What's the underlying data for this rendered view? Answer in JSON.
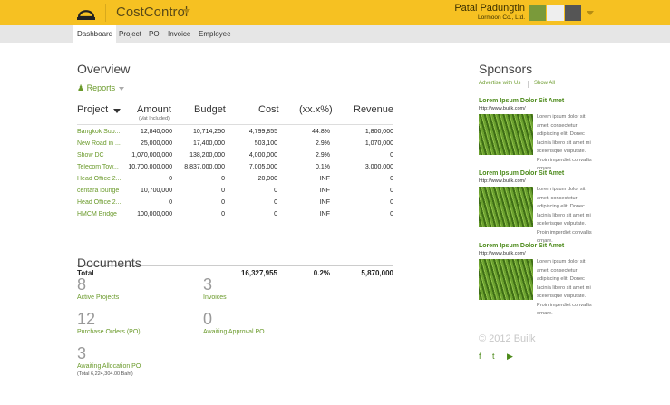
{
  "app": {
    "brand": "CostControl"
  },
  "user": {
    "name": "Patai Padungtin",
    "company": "Lormoon Co., Ltd."
  },
  "nav": {
    "tabs": [
      "Dashboard",
      "Project",
      "PO",
      "Invoice",
      "Employee"
    ],
    "active": "Dashboard"
  },
  "overview": {
    "title": "Overview",
    "reports_label": "Reports",
    "columns": {
      "project": "Project",
      "amount": "Amount",
      "amount_sub": "(Vat Included)",
      "budget": "Budget",
      "cost": "Cost",
      "ratio": "(xx.x%)",
      "revenue": "Revenue"
    },
    "rows": [
      {
        "project": "Bangkok Sup...",
        "amount": "12,840,000",
        "budget": "10,714,250",
        "cost": "4,799,855",
        "ratio": "44.8%",
        "revenue": "1,800,000"
      },
      {
        "project": "New Road in ...",
        "amount": "25,000,000",
        "budget": "17,400,000",
        "cost": "503,100",
        "ratio": "2.9%",
        "revenue": "1,070,000"
      },
      {
        "project": "Show DC",
        "amount": "1,070,000,000",
        "budget": "138,200,000",
        "cost": "4,000,000",
        "ratio": "2.9%",
        "revenue": "0"
      },
      {
        "project": "Telecom Tow...",
        "amount": "10,700,000,000",
        "budget": "8,837,000,000",
        "cost": "7,005,000",
        "ratio": "0.1%",
        "revenue": "3,000,000"
      },
      {
        "project": "Head Office 2...",
        "amount": "0",
        "budget": "0",
        "cost": "20,000",
        "ratio": "INF",
        "revenue": "0"
      },
      {
        "project": "centara lounge",
        "amount": "10,700,000",
        "budget": "0",
        "cost": "0",
        "ratio": "INF",
        "revenue": "0"
      },
      {
        "project": "Head Office 2...",
        "amount": "0",
        "budget": "0",
        "cost": "0",
        "ratio": "INF",
        "revenue": "0"
      },
      {
        "project": "HMCM Bridge",
        "amount": "100,000,000",
        "budget": "0",
        "cost": "0",
        "ratio": "INF",
        "revenue": "0"
      }
    ],
    "total": {
      "label": "Total",
      "cost": "16,327,955",
      "ratio": "0.2%",
      "revenue": "5,870,000"
    }
  },
  "documents": {
    "title": "Documents",
    "items": [
      {
        "count": "8",
        "label": "Active Projects"
      },
      {
        "count": "3",
        "label": "Invoices"
      },
      {
        "count": "12",
        "label": "Purchase Orders (PO)"
      },
      {
        "count": "0",
        "label": "Awaiting Approval PO"
      },
      {
        "count": "3",
        "label": "Awaiting Allocation PO",
        "sub": "(Total 6,224,304.00 Baht)"
      }
    ]
  },
  "sponsors": {
    "title": "Sponsors",
    "advertise": "Advertise with Us",
    "show_all": "Show All",
    "items": [
      {
        "title": "Lorem Ipsum Dolor Sit Amet",
        "url": "http://www.builk.com/",
        "text": "Lorem ipsum dolor sit amet, consectetur adipiscing elit. Donec lacinia libero sit amet mi scelerisque vulputate. Proin imperdiet convallis ornare."
      },
      {
        "title": "Lorem Ipsum Dolor Sit Amet",
        "url": "http://www.builk.com/",
        "text": "Lorem ipsum dolor sit amet, consectetur adipiscing elit. Donec lacinia libero sit amet mi scelerisque vulputate. Proin imperdiet convallis ornare."
      },
      {
        "title": "Lorem Ipsum Dolor Sit Amet",
        "url": "http://www.builk.com/",
        "text": "Lorem ipsum dolor sit amet, consectetur adipiscing elit. Donec lacinia libero sit amet mi scelerisque vulputate. Proin imperdiet convallis ornare."
      }
    ],
    "copyright": "© 2012 Builk",
    "social": [
      "f",
      "t",
      "▶"
    ]
  },
  "colors": {
    "topbar": "#f6c122",
    "accent_green": "#6a9a2a"
  },
  "icons": {
    "logo": "helmet-icon",
    "reports": "users-icon"
  }
}
